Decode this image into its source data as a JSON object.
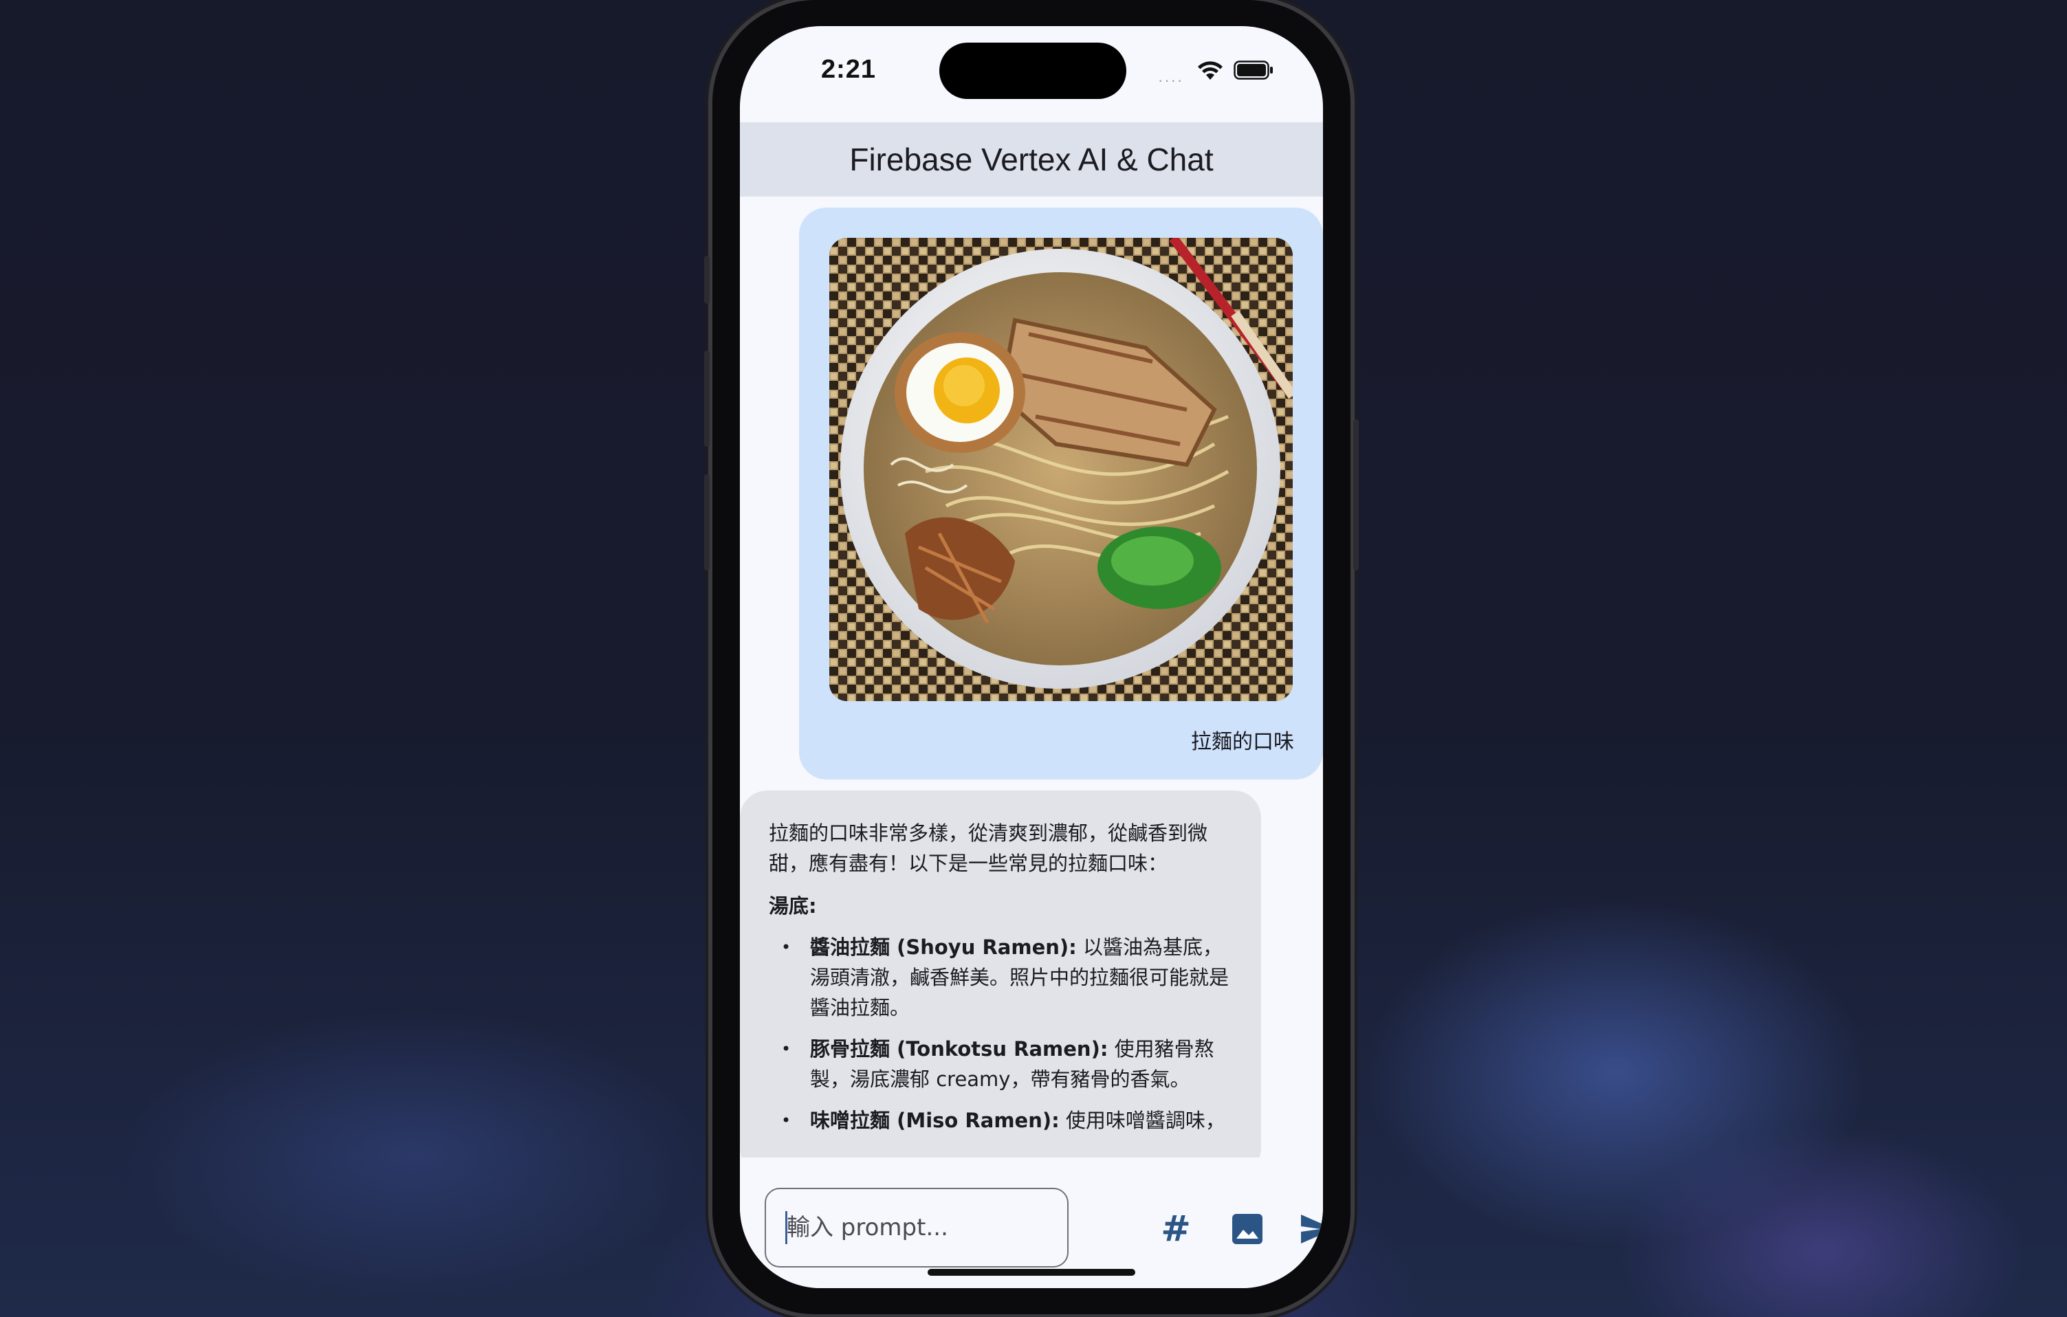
{
  "status_bar": {
    "time": "2:21",
    "signal": "····",
    "wifi_icon": "wifi-icon",
    "battery_icon": "battery-icon"
  },
  "app_bar": {
    "title": "Firebase Vertex AI & Chat"
  },
  "messages": [
    {
      "role": "user",
      "image": "ramen-photo",
      "text": "拉麵的口味"
    },
    {
      "role": "model",
      "intro": "拉麵的口味非常多樣，從清爽到濃郁，從鹹香到微甜，應有盡有！以下是一些常見的拉麵口味：",
      "heading": "湯底:",
      "items": [
        {
          "title": "醬油拉麵 (Shoyu Ramen):",
          "text": " 以醬油為基底，湯頭清澈，鹹香鮮美。照片中的拉麵很可能就是醬油拉麵。"
        },
        {
          "title": "豚骨拉麵 (Tonkotsu Ramen):",
          "text": " 使用豬骨熬製，湯底濃郁 creamy，帶有豬骨的香氣。"
        },
        {
          "title": "味噌拉麵 (Miso Ramen):",
          "text": " 使用味噌醬調味，"
        }
      ]
    }
  ],
  "input": {
    "placeholder": "輸入 prompt...",
    "value": ""
  },
  "actions": {
    "hash_icon": "#",
    "image_icon": "image-icon",
    "send_icon": "send-icon"
  },
  "colors": {
    "app_bar_bg": "#dde1ec",
    "user_bubble": "#cfe2fb",
    "model_bubble": "#e2e3e9",
    "accent": "#2b5584"
  }
}
